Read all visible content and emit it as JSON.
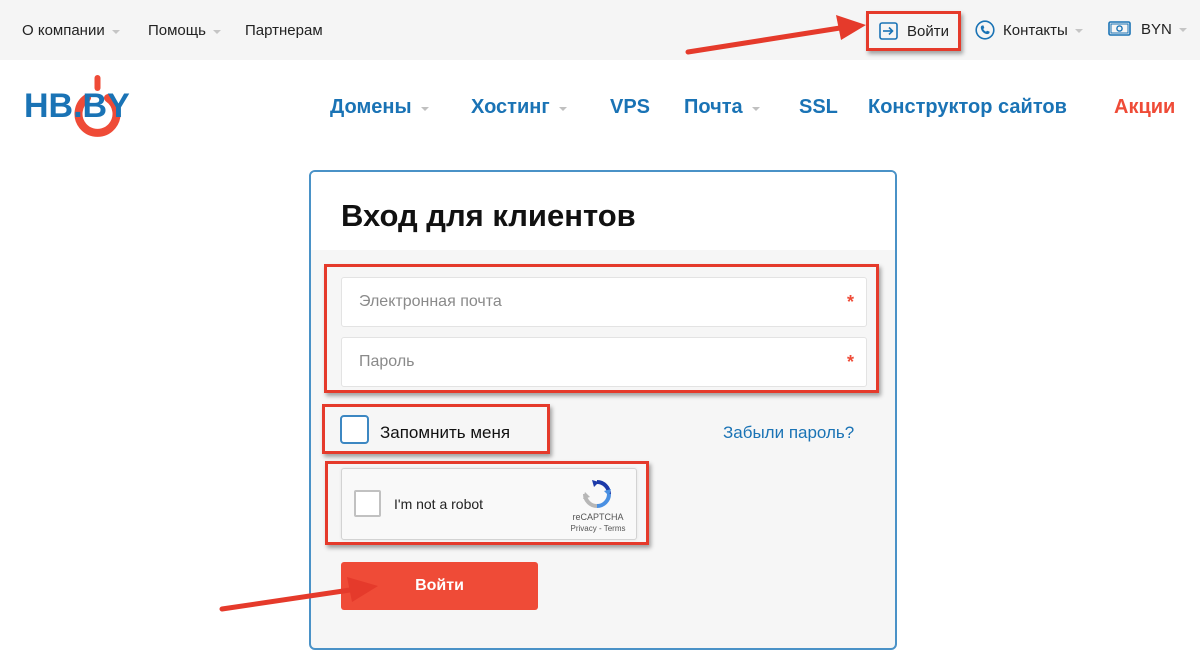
{
  "topbar": {
    "about": "О компании",
    "help": "Помощь",
    "partners": "Партнерам",
    "login": "Войти",
    "contacts": "Контакты",
    "currency": "BYN"
  },
  "logo": {
    "text": "HB.BY"
  },
  "nav": {
    "domains": "Домены",
    "hosting": "Хостинг",
    "vps": "VPS",
    "mail": "Почта",
    "ssl": "SSL",
    "builder": "Конструктор сайтов",
    "promo": "Акции"
  },
  "login_form": {
    "title": "Вход для клиентов",
    "email_placeholder": "Электронная почта",
    "password_placeholder": "Пароль",
    "required_mark": "*",
    "remember_label": "Запомнить меня",
    "forgot_link": "Забыли пароль?",
    "captcha_text": "I'm not a robot",
    "captcha_brand": "reCAPTCHA",
    "captcha_terms": "Privacy - Terms",
    "submit_label": "Войти"
  },
  "colors": {
    "accent_blue": "#1a73b5",
    "accent_red": "#ef4b37",
    "annotation_red": "#e53a2b"
  }
}
